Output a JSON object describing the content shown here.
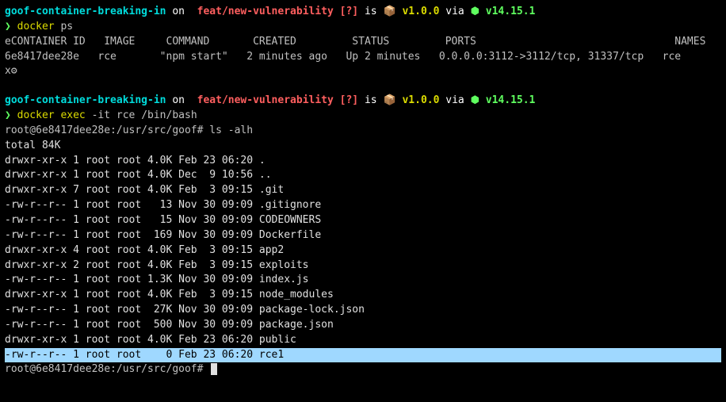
{
  "prompt1": {
    "repo": "goof-container-breaking-in",
    "on": " on ",
    "branch_icon": "",
    "branch": " feat/new-vulnerability",
    "status": " [?]",
    "is": " is ",
    "box": "📦 ",
    "version": "v1.0.0",
    "via": " via ",
    "hex": "⬢ ",
    "node": "v14.15.1"
  },
  "cmd1": {
    "symbol": "❯ ",
    "docker": "docker",
    "args": " ps"
  },
  "table": {
    "header": "eCONTAINER ID   IMAGE     COMMAND       CREATED         STATUS         PORTS                                NAMES",
    "row": "6e8417dee28e   rce       \"npm start\"   2 minutes ago   Up 2 minutes   0.0.0.0:3112->3112/tcp, 31337/tcp   rce",
    "x": "x⚙"
  },
  "prompt2": {
    "repo": "goof-container-breaking-in",
    "on": " on ",
    "branch_icon": "",
    "branch": " feat/new-vulnerability",
    "status": " [?]",
    "is": " is ",
    "box": "📦 ",
    "version": "v1.0.0",
    "via": " via ",
    "hex": "⬢ ",
    "node": "v14.15.1"
  },
  "cmd2": {
    "symbol": "❯ ",
    "docker": "docker",
    "exec": " exec",
    "flags": " -it rce /bin/bash"
  },
  "shell": {
    "prompt1": "root@6e8417dee28e:/usr/src/goof# ",
    "lscmd": "ls -alh",
    "total": "total 84K",
    "rows": [
      "drwxr-xr-x 1 root root 4.0K Feb 23 06:20 .",
      "drwxr-xr-x 1 root root 4.0K Dec  9 10:56 ..",
      "drwxr-xr-x 7 root root 4.0K Feb  3 09:15 .git",
      "-rw-r--r-- 1 root root   13 Nov 30 09:09 .gitignore",
      "-rw-r--r-- 1 root root   15 Nov 30 09:09 CODEOWNERS",
      "-rw-r--r-- 1 root root  169 Nov 30 09:09 Dockerfile",
      "drwxr-xr-x 4 root root 4.0K Feb  3 09:15 app2",
      "drwxr-xr-x 2 root root 4.0K Feb  3 09:15 exploits",
      "-rw-r--r-- 1 root root 1.3K Nov 30 09:09 index.js",
      "drwxr-xr-x 1 root root 4.0K Feb  3 09:15 node_modules",
      "-rw-r--r-- 1 root root  27K Nov 30 09:09 package-lock.json",
      "-rw-r--r-- 1 root root  500 Nov 30 09:09 package.json",
      "drwxr-xr-x 1 root root 4.0K Feb 23 06:20 public"
    ],
    "highlighted": "-rw-r--r-- 1 root root    0 Feb 23 06:20 rce1",
    "prompt2": "root@6e8417dee28e:/usr/src/goof# "
  }
}
